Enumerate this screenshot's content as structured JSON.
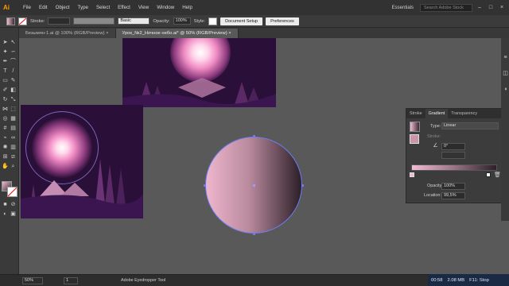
{
  "menubar": {
    "logo": "Ai",
    "items": [
      "File",
      "Edit",
      "Object",
      "Type",
      "Select",
      "Effect",
      "View",
      "Window",
      "Help"
    ],
    "workspace": "Essentials",
    "stock_placeholder": "Search Adobe Stock"
  },
  "controlbar": {
    "stroke_label": "Stroke:",
    "brush_label": "Basic",
    "opacity_label": "Opacity:",
    "opacity_value": "100%",
    "style_label": "Style:",
    "document_setup_button": "Document Setup",
    "preferences_button": "Preferences"
  },
  "tabs": [
    {
      "label": "Безымян-1.ai @ 100% (RGB/Preview)",
      "active": false
    },
    {
      "label": "Урок_№2_Ночное небо.ai* @ 50% (RGB/Preview)",
      "active": true
    }
  ],
  "gradient_panel": {
    "tabs": [
      "Stroke",
      "Gradient",
      "Transparency"
    ],
    "type_label": "Type:",
    "type_value": "Linear",
    "stroke_label": "Stroke:",
    "angle_value": "0°",
    "opacity_label": "Opacity:",
    "opacity_value": "100%",
    "location_label": "Location:",
    "location_value": "99,5%",
    "colors": {
      "start": "#f0bcd2",
      "end": "#2d1f29"
    }
  },
  "statusbar": {
    "zoom": "50%",
    "artboard_num": "1",
    "tool_name": "Adobe Eyedropper Tool"
  },
  "taskbar": {
    "time": "00:58",
    "memory": "2.08 MB",
    "hotkey": "F11: Stop"
  }
}
